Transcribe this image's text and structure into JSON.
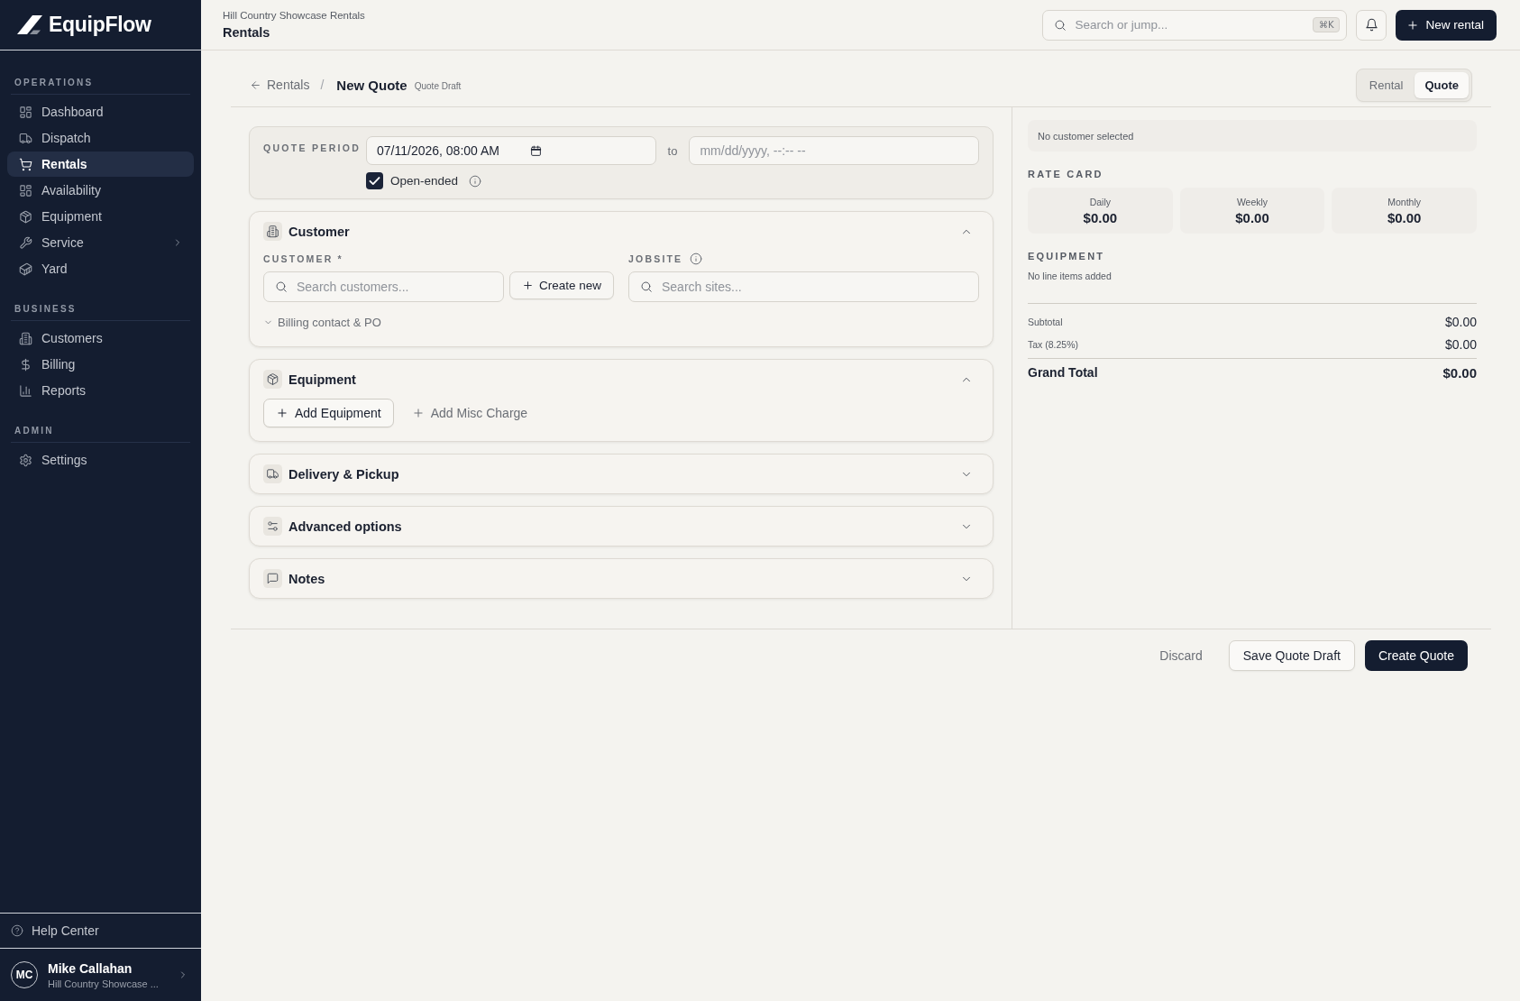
{
  "sidebar": {
    "logo": "EquipFlow",
    "sections": [
      {
        "title": "OPERATIONS",
        "items": [
          {
            "label": "Dashboard",
            "selected": false,
            "submenu": false
          },
          {
            "label": "Dispatch",
            "selected": false,
            "submenu": false
          },
          {
            "label": "Rentals",
            "selected": true,
            "submenu": false
          },
          {
            "label": "Availability",
            "selected": false,
            "submenu": false
          },
          {
            "label": "Equipment",
            "selected": false,
            "submenu": false
          },
          {
            "label": "Service",
            "selected": false,
            "submenu": true
          },
          {
            "label": "Yard",
            "selected": false,
            "submenu": false
          }
        ]
      },
      {
        "title": "BUSINESS",
        "items": [
          {
            "label": "Customers",
            "selected": false,
            "submenu": false
          },
          {
            "label": "Billing",
            "selected": false,
            "submenu": false
          },
          {
            "label": "Reports",
            "selected": false,
            "submenu": false
          }
        ]
      },
      {
        "title": "ADMIN",
        "items": [
          {
            "label": "Settings",
            "selected": false,
            "submenu": false
          }
        ]
      }
    ],
    "help": "Help Center",
    "user": {
      "initials": "MC",
      "name": "Mike Callahan",
      "org": "Hill Country Showcase ..."
    }
  },
  "topbar": {
    "org": "Hill Country Showcase Rentals",
    "title": "Rentals",
    "search": {
      "placeholder": "Search or jump...",
      "shortcut": "⌘K"
    },
    "new_button": "New rental"
  },
  "breadcrumb": {
    "back": "Rentals",
    "separator": "/",
    "title": "New Quote",
    "status": "Quote Draft"
  },
  "mode_tabs": [
    {
      "label": "Rental",
      "selected": false
    },
    {
      "label": "Quote",
      "selected": true
    }
  ],
  "quote_period": {
    "label": "QUOTE PERIOD",
    "start": "07/11/2026, 08:00 AM",
    "to": "to",
    "end": {
      "placeholder": "mm/dd/yyyy, --:-- --"
    },
    "open_ended": {
      "label": "Open-ended",
      "checked": true
    }
  },
  "sections": [
    {
      "kind": "customer",
      "title": "Customer",
      "expanded": true,
      "customer_label": "CUSTOMER *",
      "customer_search": {
        "placeholder": "Search customers..."
      },
      "create_button": "Create new",
      "jobsite_label": "JOBSITE",
      "jobsite_search": {
        "placeholder": "Search sites..."
      },
      "billing": {
        "label": "Billing contact & PO",
        "expanded": false
      }
    },
    {
      "kind": "equipment",
      "title": "Equipment",
      "expanded": true,
      "buttons": [
        {
          "label": "Add Equipment",
          "kind": "outline"
        },
        {
          "label": "Add Misc Charge",
          "kind": "ghost"
        }
      ]
    },
    {
      "kind": "delivery",
      "title": "Delivery & Pickup",
      "expanded": false
    },
    {
      "kind": "options",
      "title": "Advanced options",
      "expanded": false
    },
    {
      "kind": "notes",
      "title": "Notes",
      "expanded": false
    }
  ],
  "summary": {
    "customer": "No customer selected",
    "rate_card": {
      "title": "RATE CARD",
      "rates": [
        {
          "label": "Daily",
          "value": "$0.00"
        },
        {
          "label": "Weekly",
          "value": "$0.00"
        },
        {
          "label": "Monthly",
          "value": "$0.00"
        }
      ]
    },
    "equipment": {
      "title": "EQUIPMENT",
      "empty": "No line items added"
    },
    "totals": [
      {
        "label": "Subtotal",
        "value": "$0.00"
      },
      {
        "label": "Tax (8.25%)",
        "value": "$0.00"
      }
    ],
    "grand_total": {
      "label": "Grand Total",
      "value": "$0.00"
    }
  },
  "actions": [
    {
      "label": "Discard",
      "kind": "ghost"
    },
    {
      "label": "Save Quote Draft",
      "kind": "secondary"
    },
    {
      "label": "Create Quote",
      "kind": "primary"
    }
  ]
}
